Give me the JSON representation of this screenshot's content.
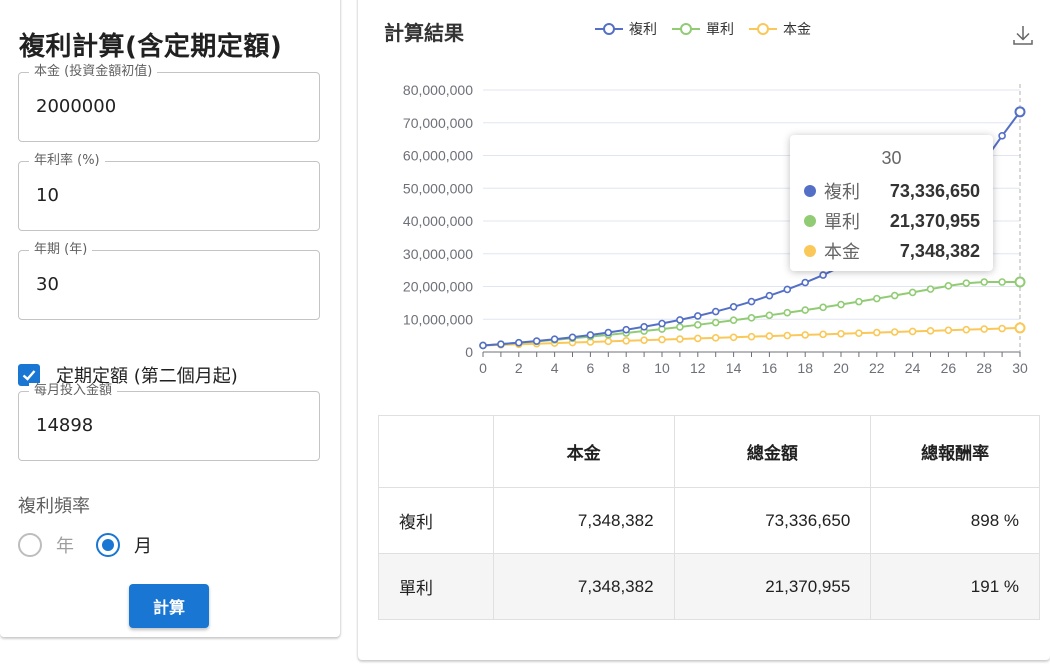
{
  "left": {
    "title": "複利計算(含定期定額)",
    "principal": {
      "label": "本金 (投資金額初值)",
      "value": "2000000"
    },
    "rate": {
      "label": "年利率 (%)",
      "value": "10"
    },
    "years": {
      "label": "年期 (年)",
      "value": "30"
    },
    "periodic": {
      "label": "定期定額 (第二個月起)",
      "checked": true
    },
    "monthly": {
      "label": "每月投入金額",
      "value": "14898"
    },
    "frequency": {
      "label": "複利頻率",
      "options": [
        {
          "label": "年",
          "selected": false
        },
        {
          "label": "月",
          "selected": true
        }
      ]
    },
    "calc_button": "計算"
  },
  "right": {
    "title": "計算結果",
    "download_icon": "download-icon",
    "tooltip": {
      "title": "30",
      "rows": [
        {
          "name": "複利",
          "value": "73,336,650",
          "color": "#5470c6"
        },
        {
          "name": "單利",
          "value": "21,370,955",
          "color": "#91cc75"
        },
        {
          "name": "本金",
          "value": "7,348,382",
          "color": "#fac858"
        }
      ]
    },
    "table": {
      "headers": [
        "",
        "本金",
        "總金額",
        "總報酬率"
      ],
      "rows": [
        [
          "複利",
          "7,348,382",
          "73,336,650",
          "898 %"
        ],
        [
          "單利",
          "7,348,382",
          "21,370,955",
          "191 %"
        ]
      ]
    }
  },
  "chart_data": {
    "type": "line",
    "title": "",
    "xlabel": "",
    "ylabel": "",
    "x": [
      0,
      1,
      2,
      3,
      4,
      5,
      6,
      7,
      8,
      9,
      10,
      11,
      12,
      13,
      14,
      15,
      16,
      17,
      18,
      19,
      20,
      21,
      22,
      23,
      24,
      25,
      26,
      27,
      28,
      29,
      30
    ],
    "x_ticks": [
      0,
      2,
      4,
      6,
      8,
      10,
      12,
      14,
      16,
      18,
      20,
      22,
      24,
      26,
      28,
      30
    ],
    "ylim": [
      0,
      80000000
    ],
    "y_ticks": [
      0,
      10000000,
      20000000,
      30000000,
      40000000,
      50000000,
      60000000,
      70000000,
      80000000
    ],
    "y_tick_labels": [
      "0",
      "10,000,000",
      "20,000,000",
      "30,000,000",
      "40,000,000",
      "50,000,000",
      "60,000,000",
      "70,000,000",
      "80,000,000"
    ],
    "legend_position": "top",
    "grid": true,
    "series": [
      {
        "name": "複利",
        "color": "#5470c6",
        "values": [
          2000000,
          2400000,
          2850000,
          3350000,
          3900000,
          4500000,
          5200000,
          5950000,
          6800000,
          7700000,
          8700000,
          9800000,
          11000000,
          12350000,
          13800000,
          15400000,
          17200000,
          19100000,
          21200000,
          23500000,
          26100000,
          28900000,
          32000000,
          35400000,
          39200000,
          43300000,
          47800000,
          52800000,
          58300000,
          66000000,
          73336650
        ]
      },
      {
        "name": "單利",
        "color": "#91cc75",
        "values": [
          2000000,
          2390000,
          2800000,
          3240000,
          3700000,
          4190000,
          4700000,
          5240000,
          5800000,
          6400000,
          7000000,
          7640000,
          8300000,
          8990000,
          9700000,
          10430000,
          11200000,
          11990000,
          12800000,
          13640000,
          14500000,
          15380000,
          16300000,
          17240000,
          18200000,
          19200000,
          20200000,
          21000000,
          21370955,
          21370955,
          21370955
        ]
      },
      {
        "name": "本金",
        "color": "#fac858",
        "values": [
          2000000,
          2178000,
          2357000,
          2535000,
          2714000,
          2892000,
          3071000,
          3249000,
          3428000,
          3607000,
          3785000,
          3964000,
          4142000,
          4321000,
          4499000,
          4678000,
          4857000,
          5035000,
          5214000,
          5392000,
          5571000,
          5749000,
          5928000,
          6106000,
          6285000,
          6464000,
          6642000,
          6821000,
          6999000,
          7170000,
          7348382
        ]
      }
    ],
    "highlight_x": 30
  }
}
